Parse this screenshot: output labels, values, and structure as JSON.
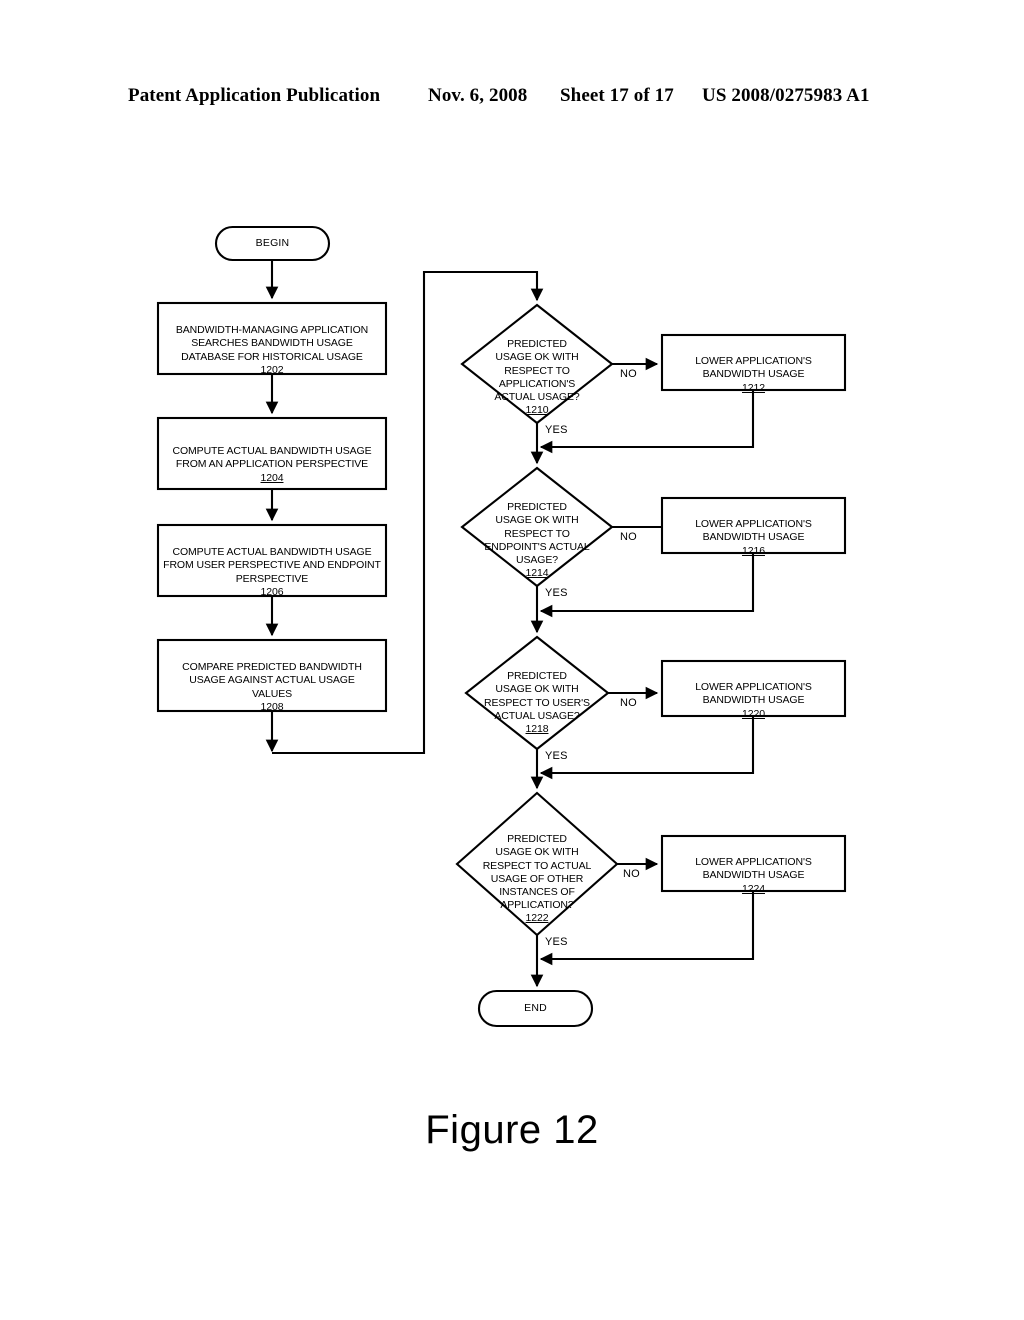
{
  "header": {
    "publication": "Patent Application Publication",
    "date": "Nov. 6, 2008",
    "sheet": "Sheet 17 of 17",
    "patent_number": "US 2008/0275983 A1"
  },
  "figure": {
    "caption": "Figure 12"
  },
  "flowchart": {
    "terminals": {
      "begin": "BEGIN",
      "end": "END"
    },
    "process_steps": [
      {
        "id": "1202",
        "text": "BANDWIDTH-MANAGING APPLICATION\nSEARCHES BANDWIDTH USAGE\nDATABASE FOR HISTORICAL USAGE",
        "ref": "1202"
      },
      {
        "id": "1204",
        "text": "COMPUTE ACTUAL BANDWIDTH USAGE\nFROM AN APPLICATION PERSPECTIVE",
        "ref": "1204"
      },
      {
        "id": "1206",
        "text": "COMPUTE ACTUAL BANDWIDTH USAGE\nFROM USER PERSPECTIVE AND ENDPOINT\nPERSPECTIVE",
        "ref": "1206"
      },
      {
        "id": "1208",
        "text": "COMPARE PREDICTED BANDWIDTH\nUSAGE AGAINST ACTUAL USAGE\nVALUES",
        "ref": "1208"
      }
    ],
    "decisions": [
      {
        "id": "1210",
        "text": "PREDICTED\nUSAGE OK WITH\nRESPECT TO\nAPPLICATION'S\nACTUAL USAGE?",
        "ref": "1210",
        "no_label": "NO",
        "yes_label": "YES"
      },
      {
        "id": "1214",
        "text": "PREDICTED\nUSAGE OK WITH\nRESPECT TO\nENDPOINT'S ACTUAL\nUSAGE?",
        "ref": "1214",
        "no_label": "NO",
        "yes_label": "YES"
      },
      {
        "id": "1218",
        "text": "PREDICTED\nUSAGE OK WITH\nRESPECT TO USER'S\nACTUAL USAGE?",
        "ref": "1218",
        "no_label": "NO",
        "yes_label": "YES"
      },
      {
        "id": "1222",
        "text": "PREDICTED\nUSAGE OK WITH\nRESPECT TO ACTUAL\nUSAGE OF OTHER\nINSTANCES OF\nAPPLICATION?",
        "ref": "1222",
        "no_label": "NO",
        "yes_label": "YES"
      }
    ],
    "actions": [
      {
        "id": "1212",
        "text": "LOWER APPLICATION'S\nBANDWIDTH USAGE",
        "ref": "1212"
      },
      {
        "id": "1216",
        "text": "LOWER APPLICATION'S\nBANDWIDTH USAGE",
        "ref": "1216"
      },
      {
        "id": "1220",
        "text": "LOWER APPLICATION'S\nBANDWIDTH USAGE",
        "ref": "1220"
      },
      {
        "id": "1224",
        "text": "LOWER APPLICATION'S\nBANDWIDTH USAGE",
        "ref": "1224"
      }
    ]
  }
}
